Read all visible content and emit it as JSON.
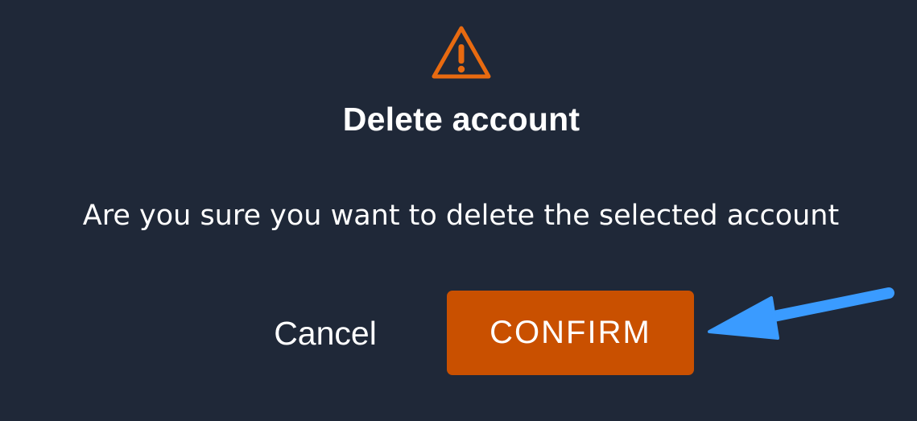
{
  "dialog": {
    "icon": "warning-triangle-icon",
    "title": "Delete account",
    "message": "Are you sure you want to delete the selected account",
    "cancel_label": "Cancel",
    "confirm_label": "CONFIRM"
  },
  "annotation": {
    "icon": "arrow-pointer-icon",
    "color": "#3a9bff"
  },
  "colors": {
    "background": "#1f2838",
    "accent": "#c95000",
    "warning": "#e86a10",
    "text": "#ffffff"
  }
}
